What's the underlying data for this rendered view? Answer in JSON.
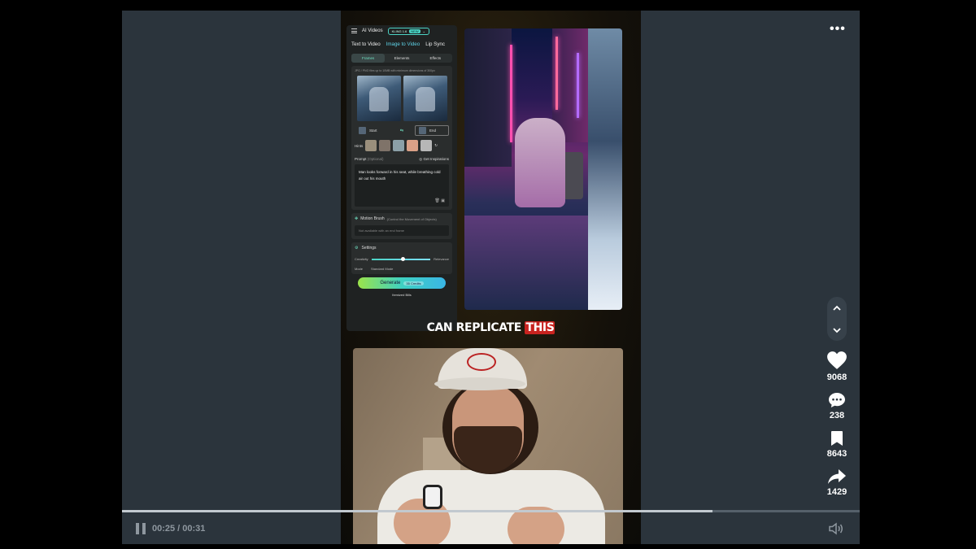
{
  "app_panel": {
    "title": "AI Videos",
    "model": "KLING 1.6",
    "model_badge": "NEW",
    "modes": [
      "Text to Video",
      "Image to Video",
      "Lip Sync"
    ],
    "subtabs": [
      "Frames",
      "Elements",
      "Effects"
    ],
    "upload_hint": "JPG / PNG files up to 10MB with minimum dimensions of 300px",
    "start_label": "Start",
    "end_label": "End",
    "hints_label": "Hints",
    "prompt_label": "Prompt",
    "prompt_optional": "(Optional)",
    "inspirations": "Get Inspirations",
    "prompt_text": "Man looks forward in his seat, while breathing cold air out his mouth",
    "motion_brush_title": "Motion Brush",
    "motion_brush_sub": "(Control the Movement of Objects)",
    "motion_brush_field": "Not available with an end frame",
    "settings_title": "Settings",
    "creativity": "Creativity",
    "relevance": "Relevance",
    "mode_label": "Mode",
    "mode_value": "Standard Mode",
    "generate": "Generate",
    "credits": "35 Credits",
    "remixed_bills": "Itemized Bills"
  },
  "caption": {
    "text": "CAN REPLICATE",
    "highlight": "THIS"
  },
  "actions": {
    "likes": "9068",
    "comments": "238",
    "saves": "8643",
    "shares": "1429"
  },
  "player": {
    "current_time": "00:25",
    "separator": "/",
    "duration": "00:31",
    "progress": 0.8
  },
  "more_label": "•••"
}
